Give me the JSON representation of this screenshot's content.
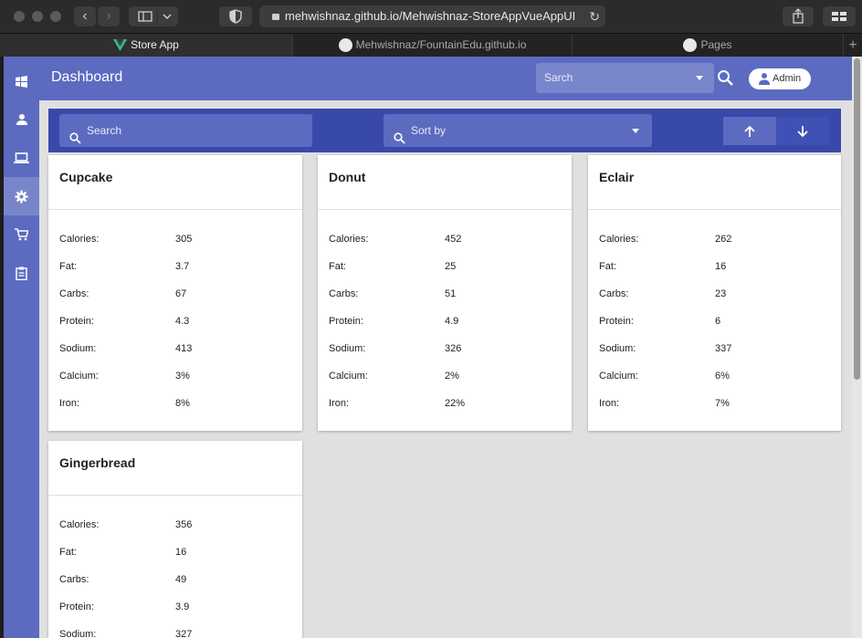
{
  "browser": {
    "url": "mehwishnaz.github.io/Mehwishnaz-StoreAppVueAppUI",
    "tabs": [
      {
        "label": "Store App"
      },
      {
        "label": "Mehwishnaz/FountainEdu.github.io"
      },
      {
        "label": "Pages"
      }
    ],
    "new_tab_symbol": "+"
  },
  "app": {
    "title": "Dashboard",
    "top_select_placeholder": "Sarch",
    "admin_label": "Admin",
    "drawer_icons": [
      "windows-icon",
      "person-icon",
      "laptop-icon",
      "gear-icon",
      "cart-icon",
      "clipboard-icon"
    ],
    "active_drawer_index": 3,
    "accent": "#5c6bc0",
    "toolbar_color": "#3949ab"
  },
  "toolbar": {
    "search_placeholder": "Search",
    "sort_placeholder": "Sort by"
  },
  "field_labels": {
    "calories": "Calories:",
    "fat": "Fat:",
    "carbs": "Carbs:",
    "protein": "Protein:",
    "sodium": "Sodium:",
    "calcium": "Calcium:",
    "iron": "Iron:"
  },
  "items": [
    {
      "name": "Cupcake",
      "calories": "305",
      "fat": "3.7",
      "carbs": "67",
      "protein": "4.3",
      "sodium": "413",
      "calcium": "3%",
      "iron": "8%"
    },
    {
      "name": "Donut",
      "calories": "452",
      "fat": "25",
      "carbs": "51",
      "protein": "4.9",
      "sodium": "326",
      "calcium": "2%",
      "iron": "22%"
    },
    {
      "name": "Eclair",
      "calories": "262",
      "fat": "16",
      "carbs": "23",
      "protein": "6",
      "sodium": "337",
      "calcium": "6%",
      "iron": "7%"
    },
    {
      "name": "Gingerbread",
      "calories": "356",
      "fat": "16",
      "carbs": "49",
      "protein": "3.9",
      "sodium": "327"
    }
  ]
}
